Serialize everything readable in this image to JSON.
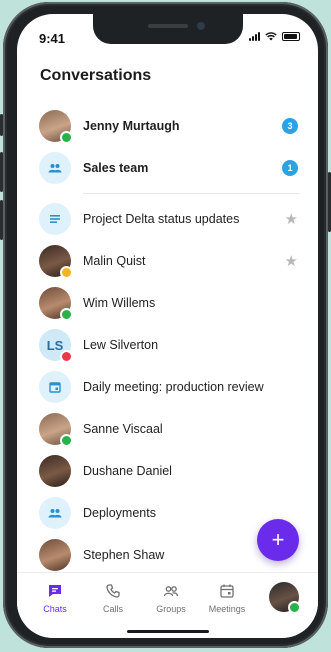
{
  "status_bar": {
    "time": "9:41"
  },
  "header": {
    "title": "Conversations"
  },
  "pinned": [
    {
      "name": "Jenny Murtaugh",
      "avatar": "photo",
      "presence": "green",
      "badge": "3"
    },
    {
      "name": "Sales team",
      "avatar": "group-icon",
      "badge": "1"
    }
  ],
  "conversations": [
    {
      "name": "Project Delta status updates",
      "avatar": "notes-icon",
      "starred": true
    },
    {
      "name": "Malin Quist",
      "avatar": "photo",
      "presence": "yellow",
      "starred": true
    },
    {
      "name": "Wim Willems",
      "avatar": "photo",
      "presence": "green"
    },
    {
      "name": "Lew Silverton",
      "avatar": "initials",
      "initials": "LS",
      "presence": "red"
    },
    {
      "name": "Daily meeting: production review",
      "avatar": "calendar-icon"
    },
    {
      "name": "Sanne Viscaal",
      "avatar": "photo",
      "presence": "green"
    },
    {
      "name": "Dushane Daniel",
      "avatar": "photo"
    },
    {
      "name": "Deployments",
      "avatar": "group-icon"
    },
    {
      "name": "Stephen Shaw",
      "avatar": "photo"
    }
  ],
  "fab": {
    "label": "+"
  },
  "tabs": [
    {
      "label": "Chats",
      "icon": "chat-icon",
      "active": true
    },
    {
      "label": "Calls",
      "icon": "phone-icon"
    },
    {
      "label": "Groups",
      "icon": "groups-icon"
    },
    {
      "label": "Meetings",
      "icon": "calendar-icon"
    }
  ],
  "colors": {
    "accent": "#6b2bea",
    "badge": "#2aa3e6",
    "online": "#27b24a",
    "away": "#f2b51c",
    "busy": "#e8394a"
  }
}
